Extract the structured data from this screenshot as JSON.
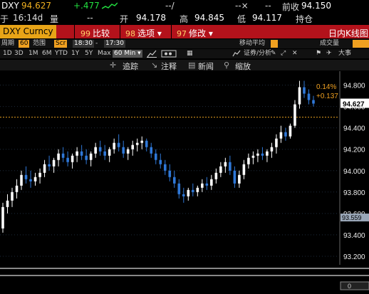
{
  "quote": {
    "symbol": "DXY",
    "last": "94.627",
    "change": "+.477",
    "dash1": "--/",
    "dash2": "--×",
    "dash3": "--",
    "prev_close_label": "前收",
    "prev_close": "94.150",
    "time_prefix": "于",
    "time": "16:14d",
    "volume_label": "量",
    "volume_value": "--",
    "open_label": "开",
    "open": "94.178",
    "high_label": "高",
    "high": "94.845",
    "low_label": "低",
    "low": "94.117",
    "position_label": "持仓"
  },
  "function_bar": {
    "ticker": "DXY Curncy",
    "items": [
      {
        "num": "99",
        "label": "比较"
      },
      {
        "num": "98",
        "label": "选项 ▾"
      },
      {
        "num": "97",
        "label": "修改 ▾"
      }
    ],
    "title": "日内K线图"
  },
  "controls": {
    "period_label": "周期",
    "period_value": "60",
    "range_label": "范围",
    "range_value": "Scr",
    "start": "18:30",
    "end": "17:30",
    "ma_label": "移动平均",
    "volume_label": "成交量"
  },
  "timeframes": [
    "1D",
    "3D",
    "1M",
    "6M",
    "YTD",
    "1Y",
    "5Y",
    "Max"
  ],
  "interval": "60 Min ▾",
  "right_tools": {
    "securities": "证券/分析",
    "large": "大事"
  },
  "toolbar": {
    "track": "追踪",
    "annotate": "注释",
    "news": "新闻",
    "zoom": "缩放"
  },
  "chart_data": {
    "type": "candlestick",
    "y_ticks": [
      "94.800",
      "94.600",
      "94.400",
      "94.200",
      "94.000",
      "93.800",
      "93.600",
      "93.400",
      "93.200"
    ],
    "last_price": "94.627",
    "marker_price": "93.559",
    "change_pct": "0.14%",
    "change_abs": "+0.137",
    "ref_line": 94.5,
    "ylim": [
      93.12,
      94.93
    ],
    "colors": {
      "up": "#ffffff",
      "down": "#2f78d8",
      "ref": "#e8a020"
    },
    "candles": [
      [
        93.46,
        93.7,
        93.42,
        93.66
      ],
      [
        93.66,
        93.78,
        93.6,
        93.72
      ],
      [
        93.72,
        93.84,
        93.66,
        93.8
      ],
      [
        93.8,
        93.92,
        93.74,
        93.86
      ],
      [
        93.86,
        94.0,
        93.82,
        93.96
      ],
      [
        93.96,
        94.04,
        93.88,
        93.92
      ],
      [
        93.92,
        94.0,
        93.84,
        93.9
      ],
      [
        93.9,
        93.98,
        93.86,
        93.94
      ],
      [
        93.94,
        94.02,
        93.88,
        93.98
      ],
      [
        93.98,
        94.1,
        93.94,
        94.06
      ],
      [
        94.06,
        94.14,
        94.0,
        94.04
      ],
      [
        94.04,
        94.12,
        93.98,
        94.1
      ],
      [
        94.1,
        94.2,
        94.04,
        94.16
      ],
      [
        94.16,
        94.22,
        94.08,
        94.12
      ],
      [
        94.12,
        94.18,
        94.04,
        94.08
      ],
      [
        94.08,
        94.16,
        94.02,
        94.14
      ],
      [
        94.14,
        94.22,
        94.08,
        94.18
      ],
      [
        94.18,
        94.24,
        94.1,
        94.14
      ],
      [
        94.14,
        94.2,
        94.06,
        94.1
      ],
      [
        94.1,
        94.18,
        94.04,
        94.16
      ],
      [
        94.16,
        94.26,
        94.12,
        94.22
      ],
      [
        94.22,
        94.28,
        94.14,
        94.18
      ],
      [
        94.18,
        94.24,
        94.1,
        94.14
      ],
      [
        94.14,
        94.22,
        94.08,
        94.2
      ],
      [
        94.2,
        94.3,
        94.16,
        94.26
      ],
      [
        94.26,
        94.34,
        94.18,
        94.22
      ],
      [
        94.22,
        94.28,
        94.12,
        94.16
      ],
      [
        94.16,
        94.22,
        94.1,
        94.2
      ],
      [
        94.2,
        94.28,
        94.14,
        94.24
      ],
      [
        94.24,
        94.3,
        94.18,
        94.26
      ],
      [
        94.26,
        94.32,
        94.2,
        94.28
      ],
      [
        94.28,
        94.3,
        94.18,
        94.22
      ],
      [
        94.22,
        94.26,
        94.12,
        94.16
      ],
      [
        94.16,
        94.2,
        94.06,
        94.1
      ],
      [
        94.1,
        94.16,
        94.02,
        94.06
      ],
      [
        94.06,
        94.1,
        93.96,
        94.0
      ],
      [
        94.0,
        94.06,
        93.9,
        93.94
      ],
      [
        93.94,
        94.0,
        93.84,
        93.88
      ],
      [
        93.88,
        93.92,
        93.74,
        93.78
      ],
      [
        93.78,
        93.84,
        93.7,
        93.76
      ],
      [
        93.76,
        93.84,
        93.72,
        93.82
      ],
      [
        93.82,
        93.88,
        93.76,
        93.8
      ],
      [
        93.8,
        93.86,
        93.76,
        93.84
      ],
      [
        93.84,
        93.92,
        93.8,
        93.88
      ],
      [
        93.88,
        93.94,
        93.82,
        93.86
      ],
      [
        93.86,
        93.96,
        93.82,
        93.92
      ],
      [
        93.92,
        94.02,
        93.88,
        93.98
      ],
      [
        93.98,
        94.08,
        93.94,
        94.04
      ],
      [
        94.04,
        94.12,
        93.98,
        94.08
      ],
      [
        94.08,
        94.14,
        93.96,
        94.0
      ],
      [
        94.0,
        94.04,
        93.84,
        93.88
      ],
      [
        93.88,
        94.0,
        93.84,
        93.96
      ],
      [
        93.96,
        94.1,
        93.92,
        94.06
      ],
      [
        94.06,
        94.16,
        94.02,
        94.12
      ],
      [
        94.12,
        94.18,
        94.06,
        94.14
      ],
      [
        94.14,
        94.2,
        94.08,
        94.16
      ],
      [
        94.16,
        94.22,
        94.1,
        94.14
      ],
      [
        94.14,
        94.2,
        94.08,
        94.18
      ],
      [
        94.18,
        94.26,
        94.12,
        94.22
      ],
      [
        94.22,
        94.34,
        94.16,
        94.3
      ],
      [
        94.3,
        94.42,
        94.26,
        94.36
      ],
      [
        94.36,
        94.4,
        94.28,
        94.32
      ],
      [
        94.32,
        94.44,
        94.3,
        94.42
      ],
      [
        94.42,
        94.66,
        94.4,
        94.62
      ],
      [
        94.62,
        94.84,
        94.58,
        94.78
      ],
      [
        94.78,
        94.84,
        94.68,
        94.72
      ],
      [
        94.72,
        94.76,
        94.62,
        94.66
      ],
      [
        94.66,
        94.7,
        94.6,
        94.627
      ]
    ]
  }
}
